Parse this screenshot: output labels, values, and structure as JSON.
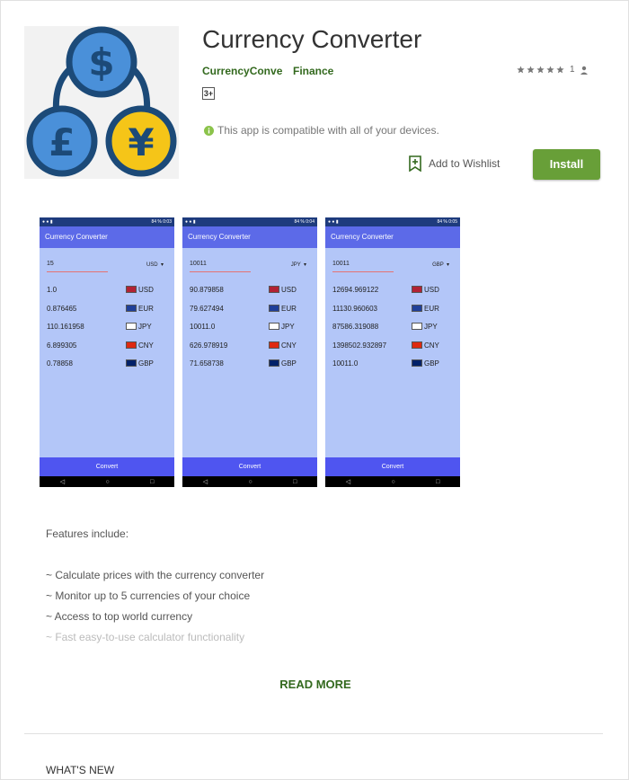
{
  "app": {
    "title": "Currency Converter",
    "developer": "CurrencyConve",
    "category": "Finance",
    "rating_count": "1",
    "stars": 5,
    "content_rating": "3+",
    "compat_text": "This app is compatible with all of your devices.",
    "wishlist_label": "Add to Wishlist",
    "install_label": "Install"
  },
  "colors": {
    "accent": "#689f38",
    "link": "#33691e",
    "logo_blue": "#4a90d9",
    "logo_yellow": "#f5c518",
    "logo_dark": "#1c4a78"
  },
  "screenshots": [
    {
      "status": "84 % 0:03",
      "appbar": "Currency Converter",
      "input": "15",
      "select": "USD",
      "rows": [
        [
          "1.0",
          "USD"
        ],
        [
          "0.876465",
          "EUR"
        ],
        [
          "110.161958",
          "JPY"
        ],
        [
          "6.899305",
          "CNY"
        ],
        [
          "0.78858",
          "GBP"
        ]
      ],
      "button": "Convert"
    },
    {
      "status": "84 % 0:04",
      "appbar": "Currency Converter",
      "input": "10011",
      "select": "JPY",
      "rows": [
        [
          "90.879858",
          "USD"
        ],
        [
          "79.627494",
          "EUR"
        ],
        [
          "10011.0",
          "JPY"
        ],
        [
          "626.978919",
          "CNY"
        ],
        [
          "71.658738",
          "GBP"
        ]
      ],
      "button": "Convert"
    },
    {
      "status": "84 % 0:05",
      "appbar": "Currency Converter",
      "input": "10011",
      "select": "GBP",
      "rows": [
        [
          "12694.969122",
          "USD"
        ],
        [
          "11130.960603",
          "EUR"
        ],
        [
          "87586.319088",
          "JPY"
        ],
        [
          "1398502.932897",
          "CNY"
        ],
        [
          "10011.0",
          "GBP"
        ]
      ],
      "button": "Convert"
    }
  ],
  "description": {
    "intro": "Features include:",
    "items": [
      "~ Calculate prices with the currency converter",
      "~ Monitor up to 5 currencies of your choice",
      "~ Access to top world currency",
      "~ Fast easy-to-use calculator functionality"
    ],
    "read_more": "READ MORE"
  },
  "whats_new": "WHAT'S NEW"
}
